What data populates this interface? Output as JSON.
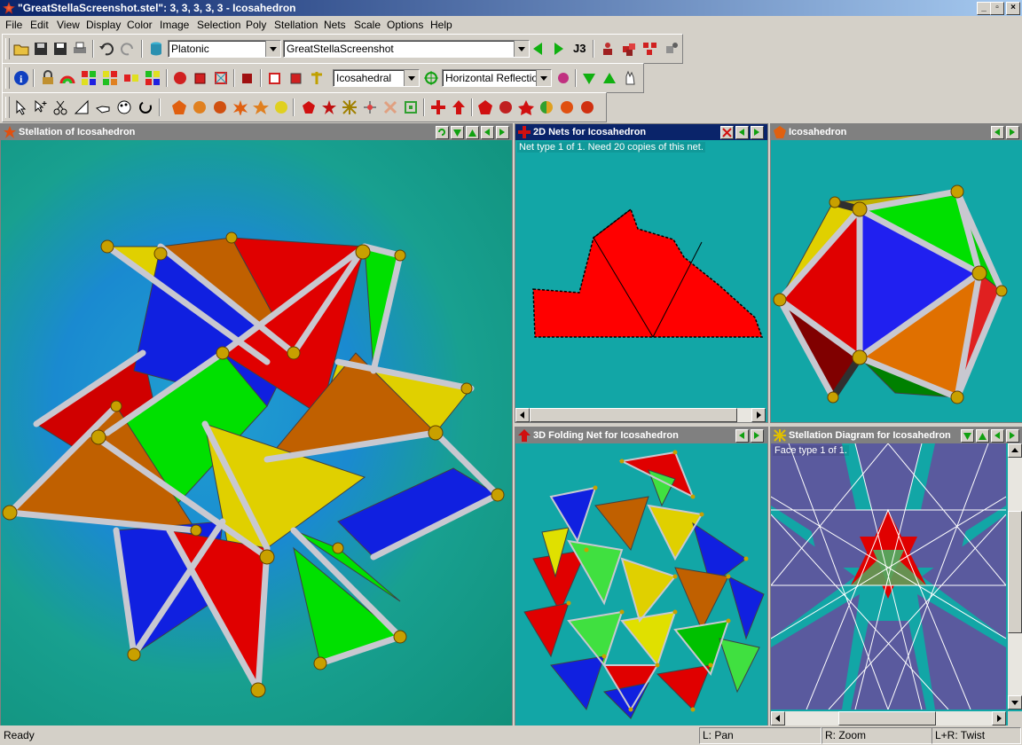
{
  "window": {
    "title": "\"GreatStellaScreenshot.stel\": 3, 3, 3, 3, 3 - Icosahedron",
    "minimize": "_",
    "maximize": "▫",
    "close": "×"
  },
  "menu": {
    "items": [
      "File",
      "Edit",
      "View",
      "Display",
      "Color",
      "Image",
      "Selection",
      "Poly",
      "Stellation",
      "Nets",
      "Scale",
      "Options",
      "Help"
    ]
  },
  "toolbar1": {
    "category_combo": "Platonic",
    "model_combo": "GreatStellaScreenshot",
    "j3_label": "J3"
  },
  "toolbar2": {
    "symmetry_combo": "Icosahedral",
    "reflection_combo": "Horizontal Reflection"
  },
  "panels": {
    "stellation": {
      "title": "Stellation of Icosahedron"
    },
    "nets2d": {
      "title": "2D Nets for Icosahedron",
      "info": "Net type 1 of 1.  Need 20 copies of this net."
    },
    "icosahedron": {
      "title": "Icosahedron"
    },
    "folding3d": {
      "title": "3D Folding Net for Icosahedron"
    },
    "diagram": {
      "title": "Stellation Diagram for Icosahedron",
      "info": "Face type 1 of 1."
    }
  },
  "status": {
    "ready": "Ready",
    "pan": "L: Pan",
    "zoom": "R: Zoom",
    "twist": "L+R: Twist"
  },
  "colors": {
    "title_active": "#0a246a",
    "panel_bg": "#12a6a6",
    "net_red": "#ff0000",
    "diagram_purple": "#5a5a9e"
  },
  "icons": [
    "open-folder-icon",
    "save-icon",
    "save-as-icon",
    "print-icon",
    "undo-icon",
    "redo-icon",
    "database-icon",
    "arrow-left-icon",
    "arrow-right-icon",
    "info-icon",
    "lock-icon",
    "rainbow-icon",
    "color-grid-icon",
    "select-icon",
    "stellation-icon",
    "fold-icon"
  ]
}
